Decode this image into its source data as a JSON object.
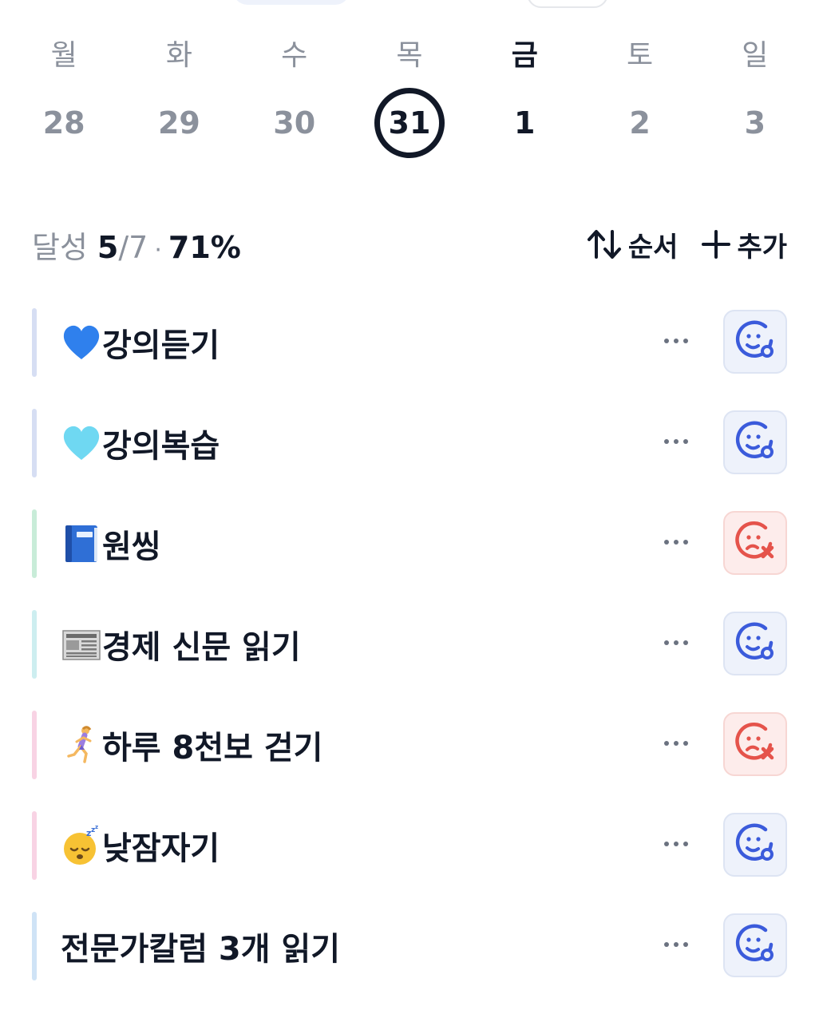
{
  "week": [
    {
      "name": "월",
      "num": "28",
      "state": "past"
    },
    {
      "name": "화",
      "num": "29",
      "state": "past"
    },
    {
      "name": "수",
      "num": "30",
      "state": "past"
    },
    {
      "name": "목",
      "num": "31",
      "state": "selected"
    },
    {
      "name": "금",
      "num": "1",
      "state": "today"
    },
    {
      "name": "토",
      "num": "2",
      "state": "future"
    },
    {
      "name": "일",
      "num": "3",
      "state": "future"
    }
  ],
  "summary": {
    "label": "달성",
    "done": "5",
    "total": "/7",
    "dot": "·",
    "percent": "71%",
    "sort_label": "순서",
    "add_label": "추가"
  },
  "habits": [
    {
      "title": "강의듣기",
      "icon": "blue-heart-icon",
      "status": "done",
      "accent": "#d6def3"
    },
    {
      "title": "강의복습",
      "icon": "light-blue-heart-icon",
      "status": "done",
      "accent": "#d6def3"
    },
    {
      "title": " 원씽",
      "icon": "blue-book-icon",
      "status": "failed",
      "accent": "#c8ecd8"
    },
    {
      "title": "경제 신문 읽기",
      "icon": "newspaper-icon",
      "status": "done",
      "accent": "#cdeef0"
    },
    {
      "title": "하루 8천보 걷기",
      "icon": "running-woman-icon",
      "status": "failed",
      "accent": "#f8d3e4"
    },
    {
      "title": "낮잠자기",
      "icon": "sleeping-face-icon",
      "status": "done",
      "accent": "#f8d3e4"
    },
    {
      "title": "전문가칼럼 3개 읽기",
      "icon": "",
      "status": "done",
      "accent": "#cfe3f6"
    }
  ],
  "colors": {
    "ok": "#3b5bdb",
    "fail": "#e5534b",
    "muted": "#8b919c",
    "text": "#111827"
  }
}
